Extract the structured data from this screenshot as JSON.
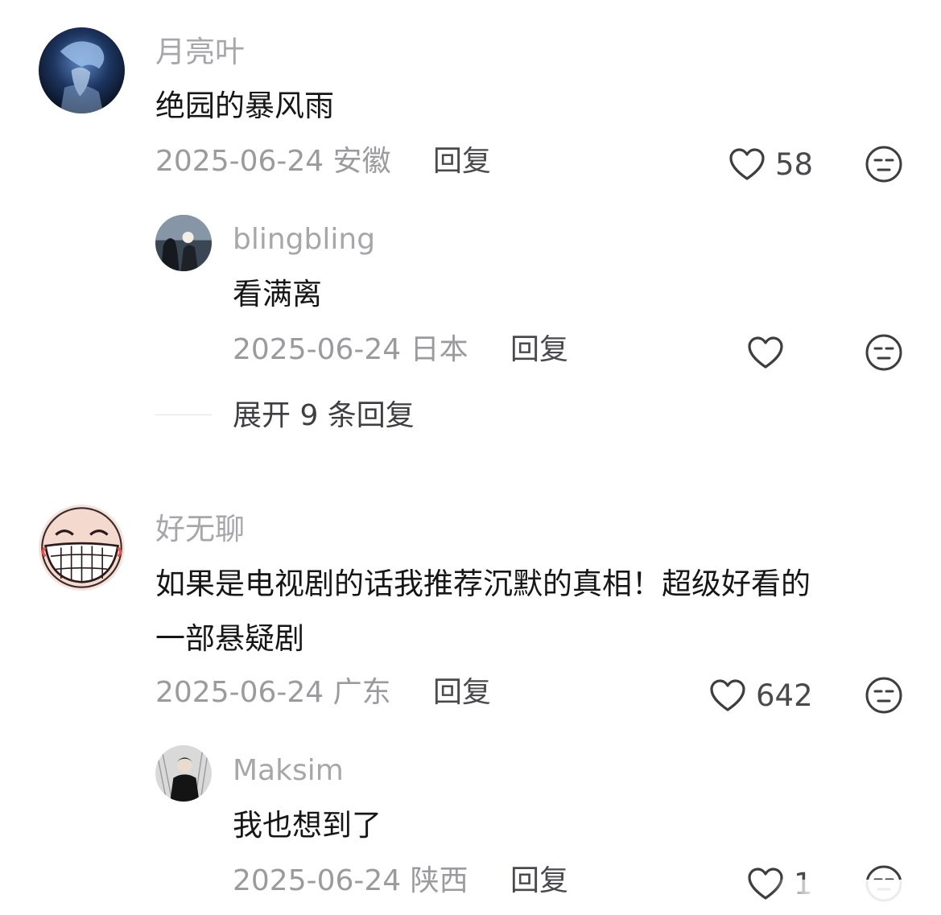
{
  "comments": [
    {
      "username": "月亮叶",
      "content": "绝园的暴风雨",
      "date": "2025-06-24",
      "location": "安徽",
      "reply_label": "回复",
      "likes": "58",
      "replies": [
        {
          "username": "blingbling",
          "content": "看满离",
          "date": "2025-06-24",
          "location": "日本",
          "reply_label": "回复",
          "likes": ""
        }
      ],
      "expand_label": "展开 9 条回复"
    },
    {
      "username": "好无聊",
      "content_line1": "如果是电视剧的话我推荐沉默的真相！超级好看的",
      "content_line2": "一部悬疑剧",
      "date": "2025-06-24",
      "location": "广东",
      "reply_label": "回复",
      "likes": "642",
      "replies": [
        {
          "username": "Maksim",
          "content": "我也想到了",
          "date": "2025-06-24",
          "location": "陕西",
          "reply_label": "回复",
          "likes": "1"
        }
      ]
    }
  ],
  "icons": {
    "like": "heart-outline-icon",
    "dislike": "neutral-face-icon"
  },
  "colors": {
    "username": "#a7a7ab",
    "content": "#161616",
    "meta": "#9b9b9f",
    "action": "#4a4a4e"
  }
}
